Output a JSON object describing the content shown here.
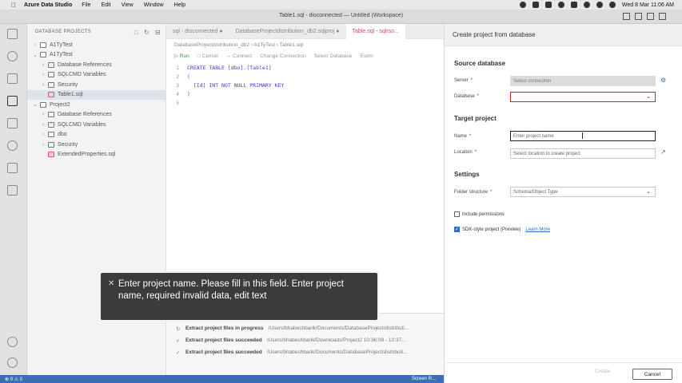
{
  "menubar": {
    "app_name": "Azure Data Studio",
    "items": [
      "File",
      "Edit",
      "View",
      "Window",
      "Help"
    ],
    "datetime": "Wed 8 Mar  11:06 AM"
  },
  "window": {
    "title": "Table1.sql - disconnected — Untitled (Workspace)"
  },
  "sidebar": {
    "header": "DATABASE PROJECTS",
    "tree": [
      {
        "label": "A1TyTest",
        "level": 0,
        "chev": "›",
        "icon": "proj"
      },
      {
        "label": "A1TyTest",
        "level": 0,
        "chev": "⌄",
        "icon": "proj"
      },
      {
        "label": "Database References",
        "level": 1,
        "chev": "›",
        "icon": "ref"
      },
      {
        "label": "SQLCMD Variables",
        "level": 1,
        "chev": "›",
        "icon": "var"
      },
      {
        "label": "Security",
        "level": 1,
        "chev": "›",
        "icon": "folder"
      },
      {
        "label": "Table1.sql",
        "level": 1,
        "chev": "",
        "icon": "sql",
        "selected": true
      },
      {
        "label": "Project2",
        "level": 0,
        "chev": "⌄",
        "icon": "proj"
      },
      {
        "label": "Database References",
        "level": 1,
        "chev": "›",
        "icon": "ref"
      },
      {
        "label": "SQLCMD Variables",
        "level": 1,
        "chev": "›",
        "icon": "var"
      },
      {
        "label": "dbo",
        "level": 1,
        "chev": "›",
        "icon": "folder"
      },
      {
        "label": "Security",
        "level": 1,
        "chev": "›",
        "icon": "folder"
      },
      {
        "label": "ExtendedProperties.sql",
        "level": 1,
        "chev": "",
        "icon": "sql"
      }
    ]
  },
  "editor": {
    "tabs": [
      {
        "label": "sql - disconnected  ●",
        "active": false
      },
      {
        "label": "DatabaseProjectdistribution_db2.sqlproj  ●",
        "active": false
      },
      {
        "label": "Table.sql - sqlrso...",
        "active": true
      }
    ],
    "breadcrumb": "DatabaseProjectdistribution_db2  ›  A1TyTest  ›  Table1.sql",
    "toolbar": {
      "run": "▷ Run",
      "cancel": "□ Cancel",
      "connect": "↔ Connect",
      "change": "Change Connection",
      "select_db": "Select Database",
      "estimate": "Estim"
    },
    "code": [
      {
        "n": "1",
        "t": "CREATE TABLE [dbo].[Table1]"
      },
      {
        "n": "2",
        "t": "("
      },
      {
        "n": "3",
        "t": "  [Id] INT NOT NULL PRIMARY KEY"
      },
      {
        "n": "4",
        "t": ")"
      },
      {
        "n": "5",
        "t": ""
      }
    ]
  },
  "output": [
    {
      "status": "Extract project files in progress",
      "path": "/Users/bhabeshbarik/Documents/DatabaseProject/distributi..."
    },
    {
      "status": "Extract project files succeeded",
      "path": "/Users/bhabeshbarik/Downloads/Project2   10:36:09 - 10:37..."
    },
    {
      "status": "Extract project files succeeded",
      "path": "/Users/bhabeshbarik/Documents/DatabaseProject/distributi..."
    }
  ],
  "statusbar": {
    "left": "⊗ 0 ⚠ 0",
    "right": "Screen R..."
  },
  "tooltip": {
    "text": "Enter project name. Please fill in this field. Enter project name, required invalid data, edit text"
  },
  "dialog": {
    "title": "Create project from database",
    "source_section": "Source database",
    "server_label": "Server",
    "server_value": "Select connection",
    "database_label": "Database",
    "database_value": "",
    "target_section": "Target project",
    "name_label": "Name",
    "name_placeholder": "Enter project name",
    "location_label": "Location",
    "location_placeholder": "Select location to create project",
    "settings_section": "Settings",
    "folder_label": "Folder structure",
    "folder_value": "Schema/Object Type",
    "include_permissions": "Include permissions",
    "sdk_style": "SDK-style project (Preview)",
    "learn_more": "Learn More",
    "create_label": "Create",
    "cancel_label": "Cancel",
    "required_mark": "*"
  }
}
